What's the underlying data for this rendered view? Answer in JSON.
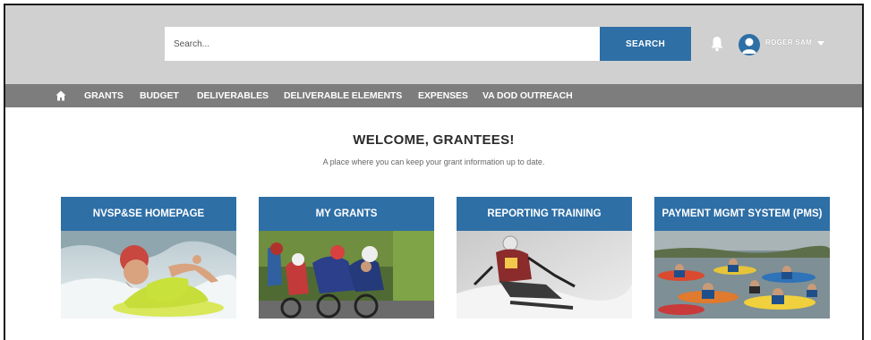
{
  "header": {
    "search": {
      "placeholder": "Search...",
      "value": ""
    },
    "search_button": "SEARCH",
    "user": {
      "name": "ROGER SAM"
    },
    "icons": {
      "notifications": "bell-icon",
      "avatar": "user-avatar-icon",
      "menu": "chevron-down-icon"
    }
  },
  "nav": {
    "home_icon": "home-icon",
    "items": [
      "GRANTS",
      "BUDGET",
      "DELIVERABLES",
      "DELIVERABLE ELEMENTS",
      "EXPENSES",
      "VA DOD OUTREACH"
    ]
  },
  "welcome": {
    "title": "WELCOME, GRANTEES!",
    "subtitle": "A place where you can keep your grant information up to date."
  },
  "tiles": [
    {
      "label": "NVSP&SE HOMEPAGE"
    },
    {
      "label": "MY GRANTS"
    },
    {
      "label": "REPORTING TRAINING"
    },
    {
      "label": "PAYMENT MGMT SYSTEM (PMS)"
    }
  ],
  "colors": {
    "accent": "#2e6fa6",
    "header_bg": "#d0d0d0",
    "nav_bg": "#7d7d7d"
  }
}
